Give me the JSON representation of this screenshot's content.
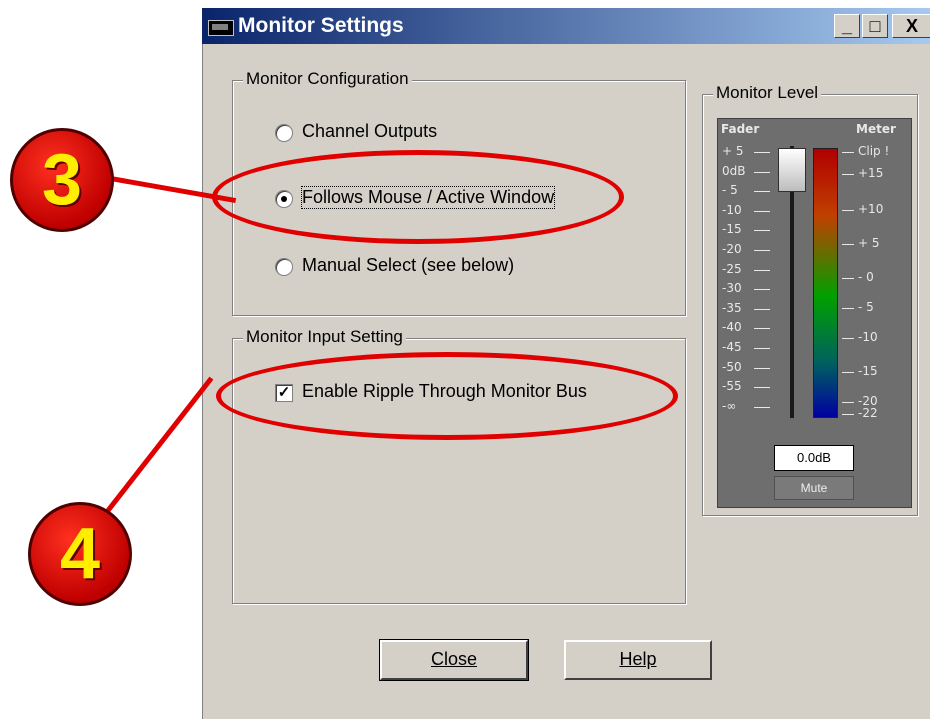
{
  "window": {
    "title": "Monitor Settings",
    "buttons": {
      "minimize": "_",
      "maximize": "□",
      "close": "X"
    }
  },
  "monitor_configuration": {
    "label": "Monitor Configuration",
    "options": [
      {
        "label": "Channel Outputs",
        "selected": false
      },
      {
        "label": "Follows Mouse / Active Window",
        "selected": true
      },
      {
        "label": "Manual Select (see below)",
        "selected": false
      }
    ]
  },
  "monitor_input_setting": {
    "label": "Monitor Input Setting",
    "ripple": {
      "label": "Enable Ripple Through Monitor Bus",
      "checked": true
    }
  },
  "monitor_level": {
    "label": "Monitor Level",
    "fader_header": "Fader",
    "meter_header": "Meter",
    "fader_ticks": [
      "+ 5",
      "0dB",
      "- 5",
      "-10",
      "-15",
      "-20",
      "-25",
      "-30",
      "-35",
      "-40",
      "-45",
      "-50",
      "-55",
      "-∞"
    ],
    "meter_ticks": [
      "Clip !",
      "+15",
      "+10",
      "+ 5",
      "- 0",
      "- 5",
      "-10",
      "-15",
      "-20",
      "-22"
    ],
    "value": "0.0dB",
    "mute_label": "Mute",
    "colors": {
      "meter_top": "#b00000",
      "meter_mid": "#00a000",
      "meter_bottom": "#0000a0"
    }
  },
  "buttons": {
    "close": "Close",
    "help": "Help"
  },
  "callouts": [
    "3",
    "4"
  ],
  "annotation_color": "#e00000"
}
